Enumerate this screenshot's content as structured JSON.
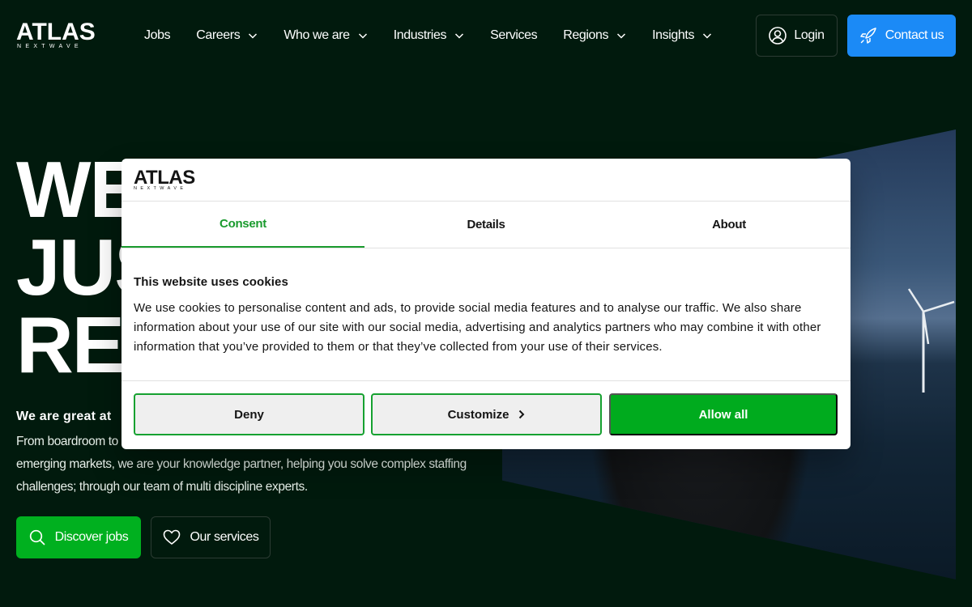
{
  "brand": {
    "name": "ATLAS",
    "tagline": "NEXTWAVE"
  },
  "nav": {
    "items": [
      {
        "label": "Jobs",
        "dropdown": false
      },
      {
        "label": "Careers",
        "dropdown": true
      },
      {
        "label": "Who we are",
        "dropdown": true
      },
      {
        "label": "Industries",
        "dropdown": true
      },
      {
        "label": "Services",
        "dropdown": false
      },
      {
        "label": "Regions",
        "dropdown": true
      },
      {
        "label": "Insights",
        "dropdown": true
      }
    ],
    "login_label": "Login",
    "contact_label": "Contact us"
  },
  "hero": {
    "headline_lines": [
      "WE",
      "JUS",
      "RE"
    ],
    "lead_bold": "We are great at",
    "lead_line1": "From boardroom to",
    "lead_line2": "emerging markets, we are your knowledge partner, helping you solve complex staffing",
    "lead_line3": "challenges; through our team of multi discipline experts.",
    "discover_label": "Discover jobs",
    "services_label": "Our services"
  },
  "cookie_dialog": {
    "brand": {
      "name": "ATLAS",
      "tagline": "NEXTWAVE"
    },
    "tabs": [
      {
        "label": "Consent",
        "active": true
      },
      {
        "label": "Details",
        "active": false
      },
      {
        "label": "About",
        "active": false
      }
    ],
    "title": "This website uses cookies",
    "text": "We use cookies to personalise content and ads, to provide social media features and to analyse our traffic. We also share information about your use of our site with our social media, advertising and analytics partners who may combine it with other information that you’ve provided to them or that they’ve collected from your use of their services.",
    "deny_label": "Deny",
    "customize_label": "Customize",
    "allow_label": "Allow all"
  },
  "colors": {
    "background": "#011a0d",
    "contact_button": "#1b8af6",
    "discover_button": "#00b01f",
    "consent_accent": "#1a9b2e",
    "allow_button": "#00ab1e"
  },
  "icons": {
    "login": "user-circle-icon",
    "contact": "rocket-icon",
    "discover": "search-icon",
    "services": "heart-icon",
    "dropdown": "chevron-down-icon",
    "customize": "chevron-right-icon"
  }
}
